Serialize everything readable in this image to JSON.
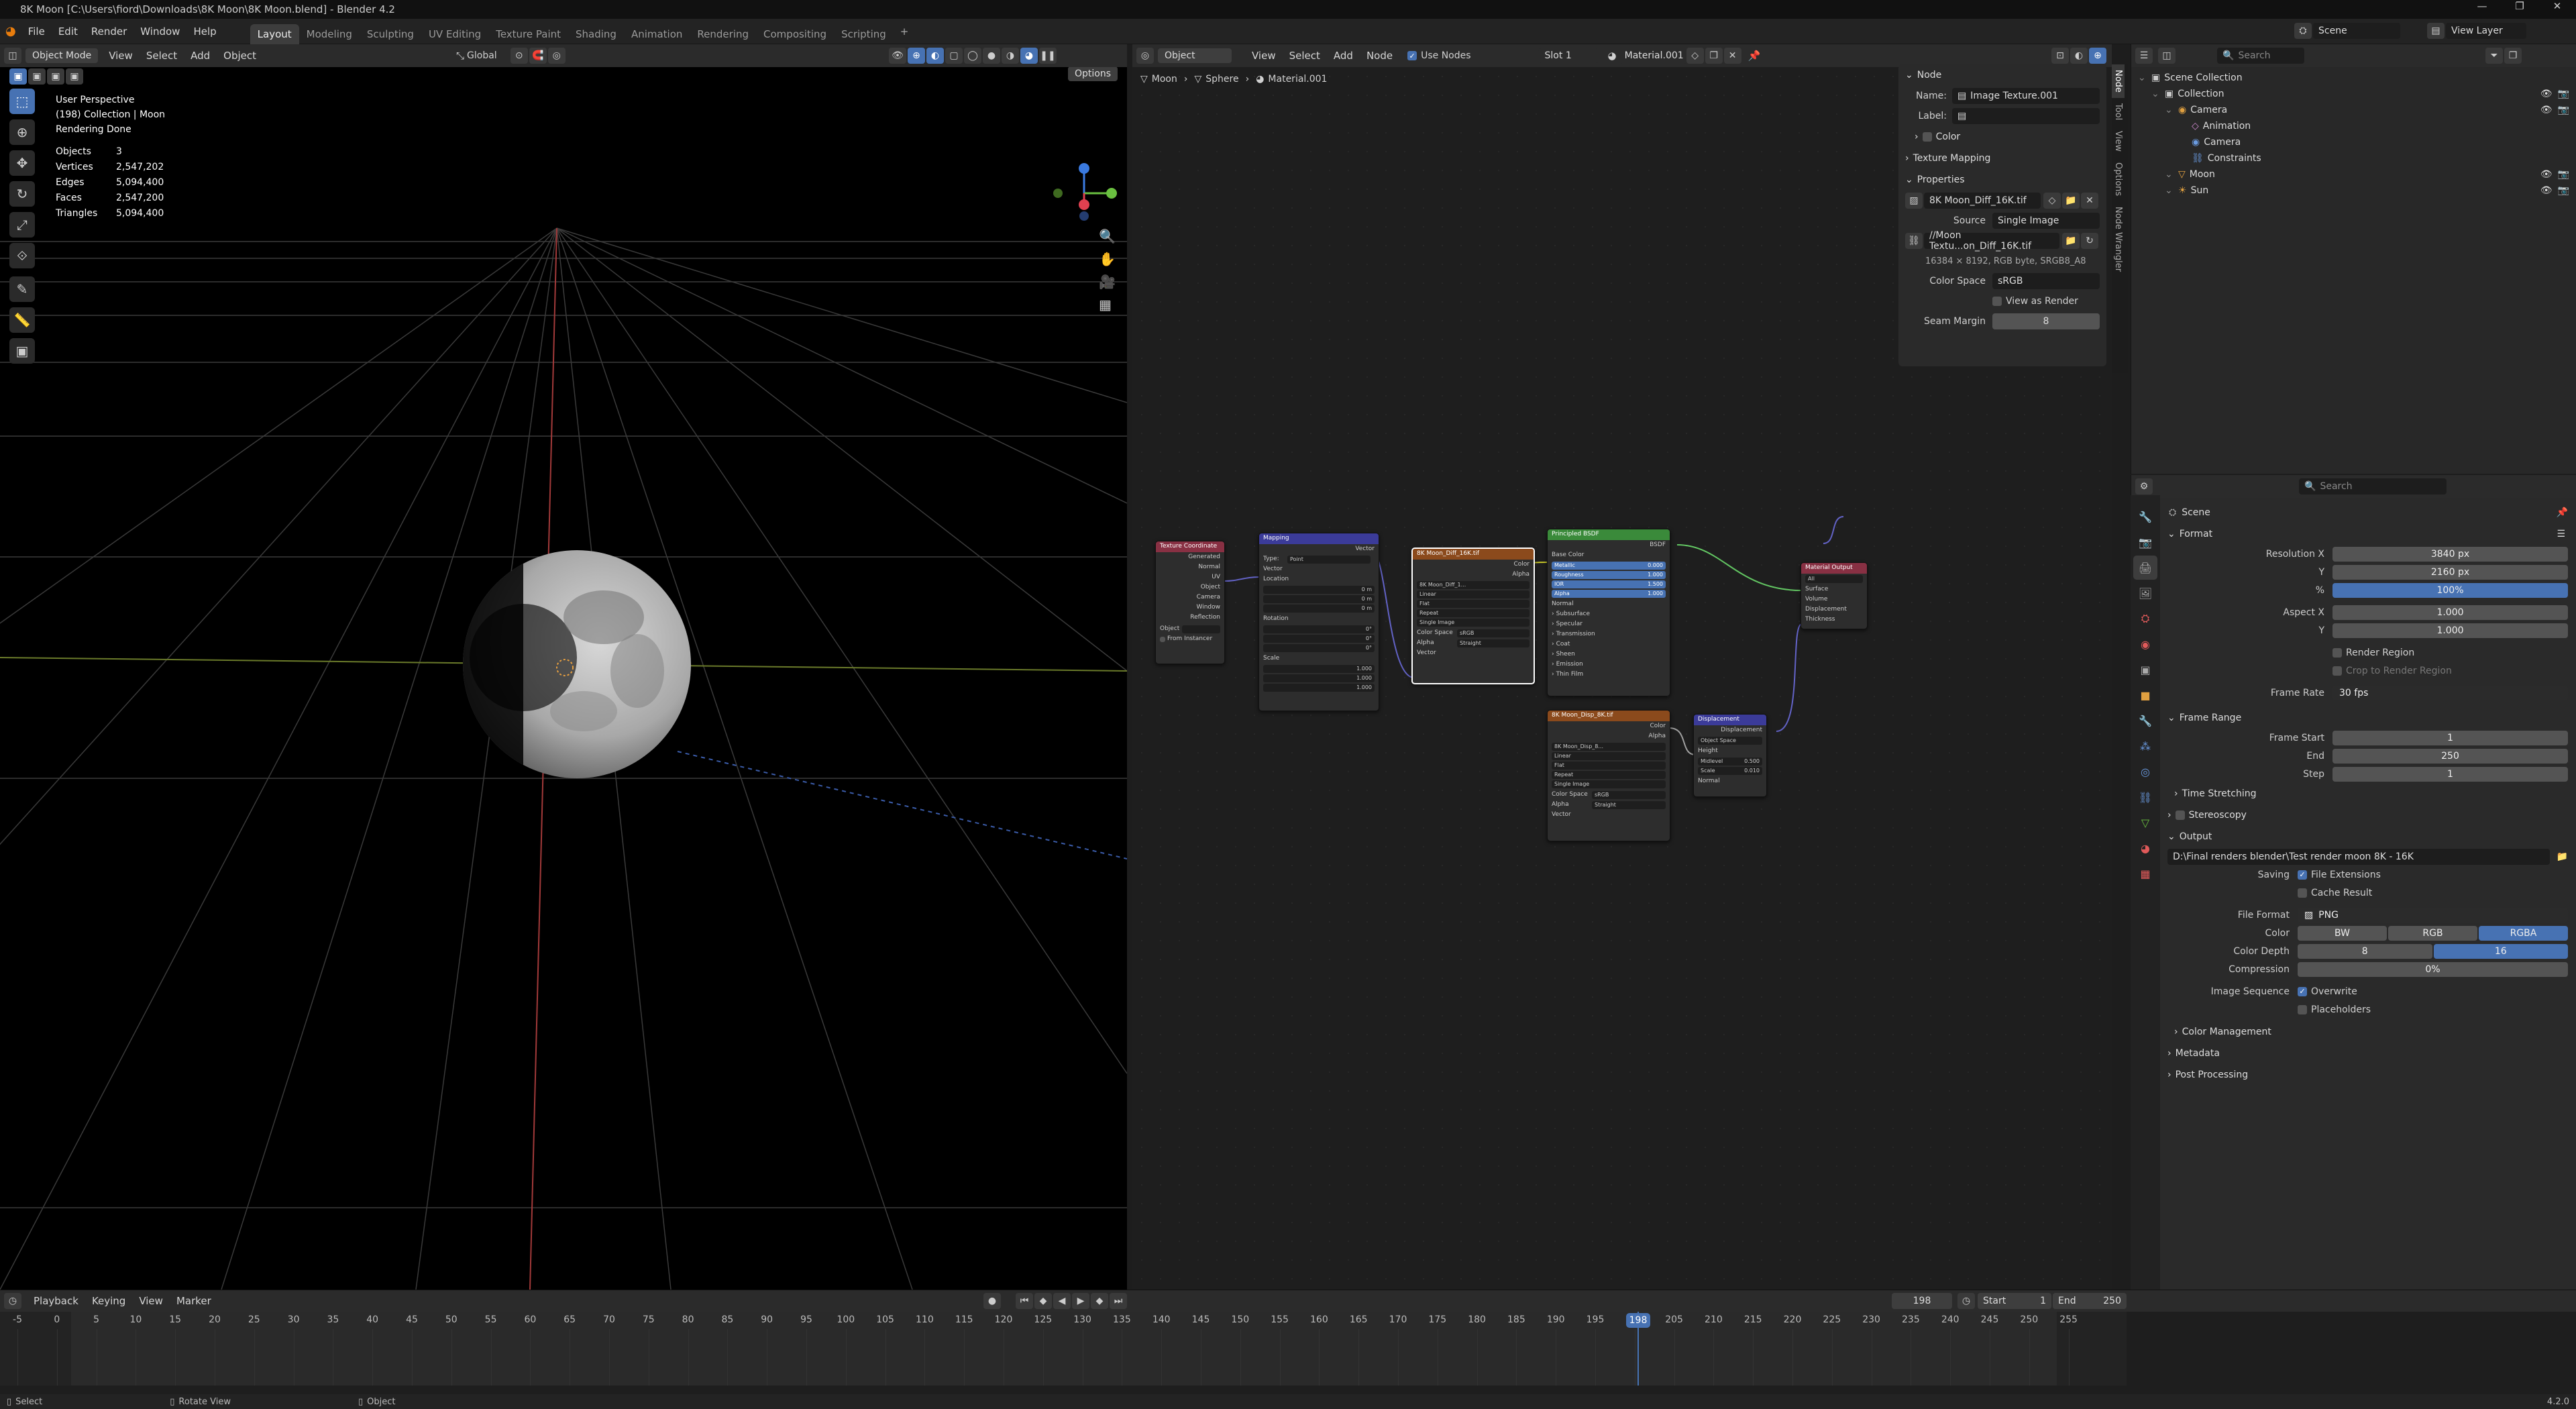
{
  "title": "8K Moon [C:\\Users\\fiord\\Downloads\\8K Moon\\8K Moon.blend] - Blender 4.2",
  "menu": [
    "File",
    "Edit",
    "Render",
    "Window",
    "Help"
  ],
  "workspaces": [
    "Layout",
    "Modeling",
    "Sculpting",
    "UV Editing",
    "Texture Paint",
    "Shading",
    "Animation",
    "Rendering",
    "Compositing",
    "Scripting"
  ],
  "active_workspace": "Layout",
  "scene_name": "Scene",
  "view_layer": "View Layer",
  "viewport": {
    "mode": "Object Mode",
    "menus": [
      "View",
      "Select",
      "Add",
      "Object"
    ],
    "orientation": "Global",
    "options": "Options",
    "info_lines": [
      "User Perspective",
      "(198) Collection | Moon",
      "Rendering Done"
    ],
    "stats": [
      [
        "Objects",
        "3"
      ],
      [
        "Vertices",
        "2,547,202"
      ],
      [
        "Edges",
        "5,094,400"
      ],
      [
        "Faces",
        "2,547,200"
      ],
      [
        "Triangles",
        "5,094,400"
      ]
    ]
  },
  "node_editor": {
    "object": "Object",
    "menus": [
      "View",
      "Select",
      "Add",
      "Node"
    ],
    "use_nodes": "Use Nodes",
    "slot": "Slot 1",
    "material": "Material.001",
    "breadcrumb": [
      "Moon",
      "Sphere",
      "Material.001"
    ],
    "nodes": {
      "texcoord": {
        "title": "Texture Coordinate",
        "outs": [
          "Generated",
          "Normal",
          "UV",
          "Object",
          "Camera",
          "Window",
          "Reflection"
        ],
        "obj": "Object",
        "inst": "From Instancer"
      },
      "mapping": {
        "title": "Mapping",
        "out": "Vector",
        "type_lbl": "Type:",
        "type": "Point",
        "ins": [
          "Vector",
          "Location",
          "Rotation",
          "Scale"
        ],
        "loc": [
          "0 m",
          "0 m",
          "0 m"
        ],
        "rot": [
          "0°",
          "0°",
          "0°"
        ],
        "scale": [
          "1.000",
          "1.000",
          "1.000"
        ]
      },
      "img1": {
        "title": "8K Moon_Diff_16K.tif",
        "outs": [
          "Color",
          "Alpha"
        ],
        "img": "8K Moon_Diff_1...",
        "opts": [
          "Linear",
          "Flat",
          "Repeat",
          "Single Image"
        ],
        "cs_lbl": "Color Space",
        "cs": "sRGB",
        "alpha_lbl": "Alpha",
        "alpha": "Straight",
        "in": "Vector"
      },
      "bsdf": {
        "title": "Principled BSDF",
        "out": "BSDF",
        "rows": [
          "Base Color",
          "Metallic",
          "Roughness",
          "IOR",
          "Alpha",
          "Normal",
          "Subsurface",
          "Specular",
          "Transmission",
          "Coat",
          "Sheen",
          "Emission",
          "Thin Film"
        ],
        "vals": [
          "",
          "0.000",
          "1.000",
          "1.500",
          "1.000",
          "",
          "",
          "",
          "",
          "",
          "",
          "",
          ""
        ]
      },
      "img2": {
        "title": "8K Moon_Disp_8K.tif",
        "outs": [
          "Color",
          "Alpha"
        ],
        "img": "8K Moon_Disp_8...",
        "opts": [
          "Linear",
          "Flat",
          "Repeat",
          "Single Image"
        ],
        "cs_lbl": "Color Space",
        "cs": "sRGB",
        "alpha_lbl": "Alpha",
        "alpha": "Straight",
        "in": "Vector"
      },
      "disp": {
        "title": "Displacement",
        "out": "Displacement",
        "space": "Object Space",
        "ins": [
          "Height",
          "Midlevel",
          "Scale",
          "Normal"
        ],
        "vals": [
          "",
          "0.500",
          "0.010",
          ""
        ]
      },
      "output": {
        "title": "Material Output",
        "target": "All",
        "ins": [
          "Surface",
          "Volume",
          "Displacement",
          "Thickness"
        ]
      }
    }
  },
  "npanel": {
    "tabs": [
      "Node",
      "Tool",
      "View",
      "Options",
      "Node Wrangler"
    ],
    "node_hdr": "Node",
    "name_lbl": "Name:",
    "name": "Image Texture.001",
    "label_lbl": "Label:",
    "color": "Color",
    "texmap": "Texture Mapping",
    "props": "Properties",
    "image": "8K Moon_Diff_16K.tif",
    "source_lbl": "Source",
    "source": "Single Image",
    "path": "//Moon Textu...on_Diff_16K.tif",
    "imginfo": "16384 × 8192, RGB byte, SRGB8_A8",
    "cs_lbl": "Color Space",
    "cs": "sRGB",
    "view_as_render": "View as Render",
    "seam_lbl": "Seam Margin",
    "seam": "8"
  },
  "outliner": {
    "search": "Search",
    "items": [
      {
        "label": "Scene Collection",
        "indent": 0,
        "icon": "▣"
      },
      {
        "label": "Collection",
        "indent": 1,
        "icon": "▣"
      },
      {
        "label": "Camera",
        "indent": 2,
        "icon": "◉"
      },
      {
        "label": "Animation",
        "indent": 3,
        "icon": "◇"
      },
      {
        "label": "Camera",
        "indent": 3,
        "icon": "◉"
      },
      {
        "label": "Constraints",
        "indent": 3,
        "icon": "⛓"
      },
      {
        "label": "Moon",
        "indent": 2,
        "icon": "▽"
      },
      {
        "label": "Sun",
        "indent": 2,
        "icon": "☀"
      }
    ]
  },
  "properties": {
    "search": "Search",
    "context": "Scene",
    "format": "Format",
    "res_x_lbl": "Resolution X",
    "res_x": "3840 px",
    "res_y_lbl": "Y",
    "res_y": "2160 px",
    "pct_lbl": "%",
    "pct": "100%",
    "aspx_lbl": "Aspect X",
    "aspx": "1.000",
    "aspy_lbl": "Y",
    "aspy": "1.000",
    "render_region": "Render Region",
    "crop": "Crop to Render Region",
    "fps_lbl": "Frame Rate",
    "fps": "30 fps",
    "frame_range": "Frame Range",
    "fstart_lbl": "Frame Start",
    "fstart": "1",
    "fend_lbl": "End",
    "fend": "250",
    "fstep_lbl": "Step",
    "fstep": "1",
    "time_stretch": "Time Stretching",
    "stereo": "Stereoscopy",
    "output": "Output",
    "out_path": "D:\\Final renders blender\\Test render moon 8K - 16K",
    "saving_lbl": "Saving",
    "file_ext": "File Extensions",
    "cache": "Cache Result",
    "ff_lbl": "File Format",
    "ff": "PNG",
    "color_lbl": "Color",
    "color_opts": [
      "BW",
      "RGB",
      "RGBA"
    ],
    "depth_lbl": "Color Depth",
    "depth_opts": [
      "8",
      "16"
    ],
    "comp_lbl": "Compression",
    "comp": "0%",
    "imgseq_lbl": "Image Sequence",
    "overwrite": "Overwrite",
    "placeholders": "Placeholders",
    "color_mgmt": "Color Management",
    "metadata": "Metadata",
    "postproc": "Post Processing"
  },
  "timeline": {
    "menus": [
      "Playback",
      "Keying",
      "View",
      "Marker"
    ],
    "current": "198",
    "start_lbl": "Start",
    "start": "1",
    "end_lbl": "End",
    "end": "250",
    "ticks": [
      "-5",
      "0",
      "5",
      "10",
      "15",
      "20",
      "25",
      "30",
      "35",
      "40",
      "45",
      "50",
      "55",
      "60",
      "65",
      "70",
      "75",
      "80",
      "85",
      "90",
      "95",
      "100",
      "105",
      "110",
      "115",
      "120",
      "125",
      "130",
      "135",
      "140",
      "145",
      "150",
      "155",
      "160",
      "165",
      "170",
      "175",
      "180",
      "185",
      "190",
      "195",
      "200",
      "205",
      "210",
      "215",
      "220",
      "225",
      "230",
      "235",
      "240",
      "245",
      "250",
      "255"
    ]
  },
  "status": {
    "items": [
      "Select",
      "Rotate View",
      "Object"
    ],
    "version": "4.2.0"
  }
}
